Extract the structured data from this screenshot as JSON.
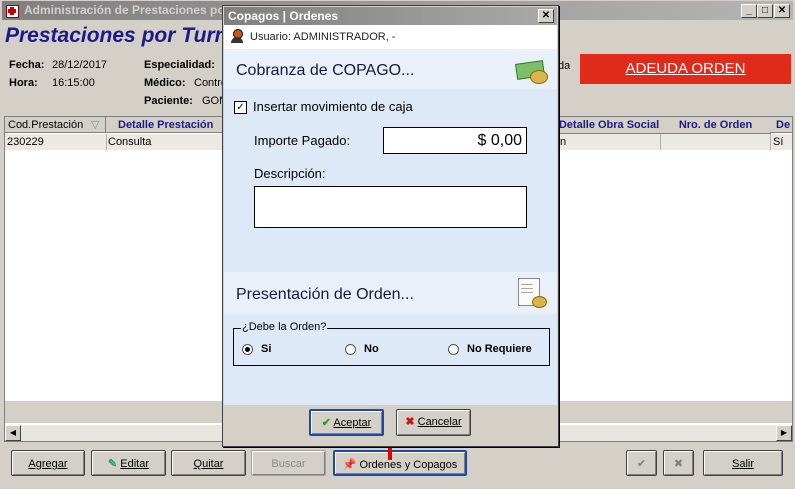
{
  "main": {
    "title": "Administración de Prestaciones por",
    "heading": "Prestaciones por Turn",
    "fecha_label": "Fecha:",
    "fecha_value": "28/12/2017",
    "hora_label": "Hora:",
    "hora_value": "16:15:00",
    "especialidad_label": "Especialidad:",
    "medico_label": "Médico:",
    "medico_value": "Contre",
    "paciente_label": "Paciente:",
    "paciente_value": "GON",
    "right_fragment": "da",
    "adeuda_label": "ADEUDA ORDEN",
    "columns": {
      "cod": "Cod.Prestación",
      "detalle": "Detalle Prestación",
      "detalle_os": "Detalle Obra Social",
      "nro_orden": "Nro. de Orden",
      "de": "De"
    },
    "row": {
      "cod": "230229",
      "detalle": "Consulta",
      "detalle_os": "n",
      "de": "Sí"
    },
    "buttons": {
      "agregar": "Agregar",
      "editar": "Editar",
      "quitar": "Quitar",
      "buscar": "Buscar",
      "ordenes": "Ordenes y Copagos",
      "salir": "Salir"
    }
  },
  "dialog": {
    "title": "Copagos | Ordenes",
    "user": "Usuario: ADMINISTRADOR, -",
    "cobranza_title": "Cobranza de COPAGO...",
    "insertar_label": "Insertar movimiento de caja",
    "insertar_checked": true,
    "importe_label": "Importe Pagado:",
    "importe_value": "$ 0,00",
    "descripcion_label": "Descripción:",
    "descripcion_value": "",
    "presentacion_title": "Presentación de Orden...",
    "debe_label": "¿Debe la Orden?",
    "options": [
      "Si",
      "No",
      "No Requiere"
    ],
    "selected_option": "Si",
    "aceptar": "Aceptar",
    "cancelar": "Cancelar"
  }
}
